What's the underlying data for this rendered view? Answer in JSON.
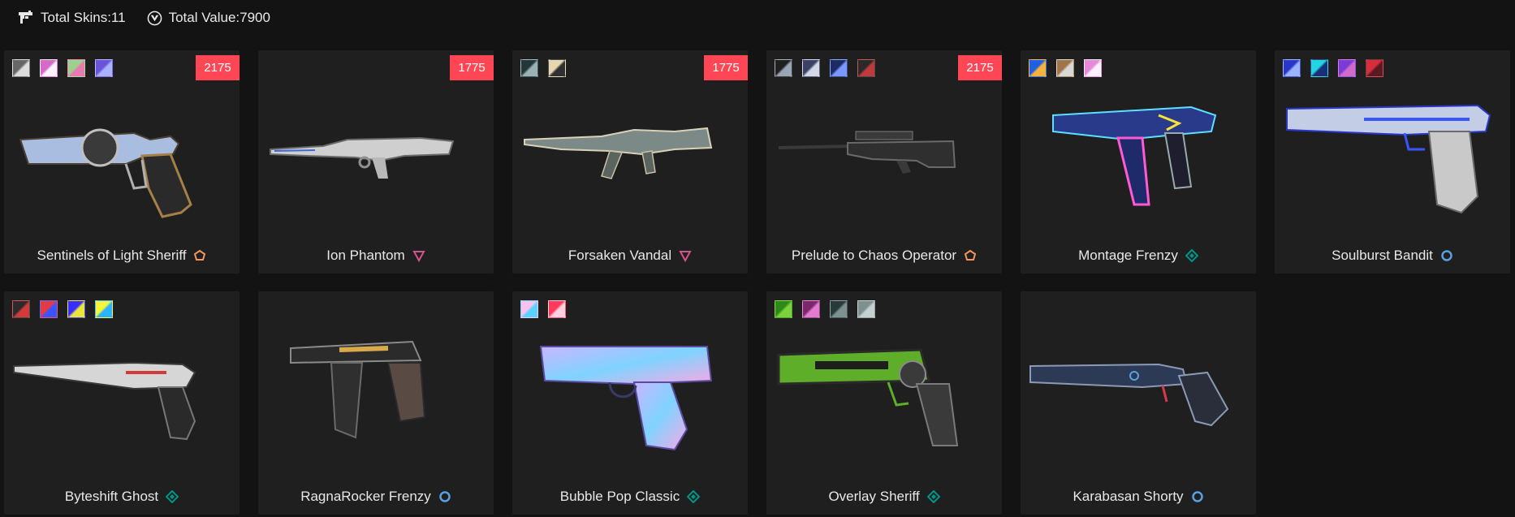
{
  "header": {
    "total_skins_label": "Total Skins:11",
    "total_value_label": "Total Value:7900"
  },
  "colors": {
    "price_badge": "#ff4655",
    "tier_exclusive": "#f5955b",
    "tier_ultra": "#d1548d",
    "tier_premium": "#5a9fe2",
    "tier_deluxe": "#009587"
  },
  "skins": [
    {
      "name": "Sentinels of Light Sheriff",
      "price": "2175",
      "tier": "exclusive",
      "tier_color": "#f5955b",
      "swatches": [
        "#666666,#dddddd",
        "#d36ac9,#fff2ff",
        "#9ecf8f,#e77ab0",
        "#6a53d8,#a8b2ff"
      ]
    },
    {
      "name": "Ion Phantom",
      "price": "1775",
      "tier": "ultra",
      "tier_color": "#d1548d",
      "swatches": []
    },
    {
      "name": "Forsaken Vandal",
      "price": "1775",
      "tier": "ultra",
      "tier_color": "#d1548d",
      "swatches": [
        "#23373a,#9ab2b3",
        "#e7d7b0,#303030"
      ]
    },
    {
      "name": "Prelude to Chaos Operator",
      "price": "2175",
      "tier": "exclusive",
      "tier_color": "#f5955b",
      "swatches": [
        "#202020,#9aa6b8",
        "#3b4266,#d4d7e6",
        "#1d2a66,#7a99ff",
        "#2a2a2a,#bf3a3a"
      ]
    },
    {
      "name": "Montage Frenzy",
      "price": "",
      "tier": "deluxe",
      "tier_color": "#009587",
      "swatches": [
        "#1f5fe0,#f5b13d",
        "#a07446,#d8d8d8",
        "#e58ad6,#fff0ff"
      ]
    },
    {
      "name": "Soulburst Bandit",
      "price": "",
      "tier": "premium",
      "tier_color": "#5a9fe2",
      "swatches": [
        "#2a36c7,#9bb2ff",
        "#23d4e3,#1a2e7a",
        "#7a3bd8,#d36ac9",
        "#d72d3c,#5a1a25"
      ]
    },
    {
      "name": "Byteshift Ghost",
      "price": "",
      "tier": "deluxe",
      "tier_color": "#009587",
      "swatches": [
        "#2b2b2b,#d33a3a",
        "#e63946,#3a55ff",
        "#3a2bff,#e8e63a",
        "#f5f53a,#2bb3ff"
      ]
    },
    {
      "name": "RagnaRocker Frenzy",
      "price": "",
      "tier": "premium",
      "tier_color": "#5a9fe2",
      "swatches": []
    },
    {
      "name": "Bubble Pop Classic",
      "price": "",
      "tier": "deluxe",
      "tier_color": "#009587",
      "swatches": [
        "#f7c2f0,#5bd2ff",
        "#ff3a5a,#ffd0e0"
      ]
    },
    {
      "name": "Overlay Sheriff",
      "price": "",
      "tier": "deluxe",
      "tier_color": "#009587",
      "swatches": [
        "#2d8a1a,#7bd13a",
        "#7a2a6a,#e47ad2",
        "#2a3a3a,#7e9090",
        "#7e9090,#c5d0d0"
      ]
    },
    {
      "name": "Karabasan Shorty",
      "price": "",
      "tier": "premium",
      "tier_color": "#5a9fe2",
      "swatches": []
    }
  ]
}
